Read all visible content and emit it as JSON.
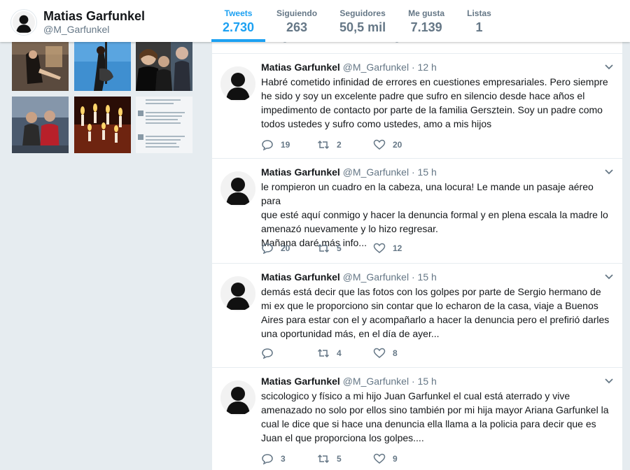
{
  "profile": {
    "name": "Matias Garfunkel",
    "handle": "@M_Garfunkel"
  },
  "stats": [
    {
      "label": "Tweets",
      "value": "2.730",
      "active": true
    },
    {
      "label": "Siguiendo",
      "value": "263",
      "active": false
    },
    {
      "label": "Seguidores",
      "value": "50,5 mil",
      "active": false
    },
    {
      "label": "Me gusta",
      "value": "7.139",
      "active": false
    },
    {
      "label": "Listas",
      "value": "1",
      "active": false
    }
  ],
  "photos": [
    {
      "desc": "woman-indoor-photo",
      "color": "#5a4a3e"
    },
    {
      "desc": "guitarist-photo",
      "color": "#3f8fd0"
    },
    {
      "desc": "politicians-photo",
      "color": "#3a3a3a"
    },
    {
      "desc": "two-men-photo",
      "color": "#4b5a6e"
    },
    {
      "desc": "candles-photo",
      "color": "#6e2410"
    },
    {
      "desc": "tweet-screenshot-photo",
      "color": "#f3f5f7"
    }
  ],
  "tweets": [
    {
      "name": "Matias Garfunkel",
      "handle": "@M_Garfunkel",
      "time": "12 h",
      "lines": [
        "Habré cometido infinidad de errores en cuestiones empresariales. Pero siempre",
        "he sido y soy un excelente padre que sufro en silencio desde hace años el",
        "impedimento de contacto por parte de la familia Gersztein. Soy un padre como",
        "todos ustedes y sufro como ustedes, amo a mis hijos"
      ],
      "replies": "19",
      "retweets": "2",
      "likes": "20"
    },
    {
      "name": "Matias Garfunkel",
      "handle": "@M_Garfunkel",
      "time": "15 h",
      "lines": [
        "le rompieron un cuadro en la cabeza, una locura! Le mande un pasaje aéreo para",
        "que esté aquí conmigo y hacer la denuncia formal y en plena escala la madre lo",
        "amenazó nuevamente y lo hizo regresar.",
        "Mañana daré más info..."
      ],
      "replies": "20",
      "retweets": "5",
      "likes": "12"
    },
    {
      "name": "Matias Garfunkel",
      "handle": "@M_Garfunkel",
      "time": "15 h",
      "lines": [
        "demás está decir que las fotos con los golpes por parte de Sergio hermano de",
        "mi ex que le proporciono sin contar que lo echaron de la casa, viaje a Buenos",
        "Aires para estar con el y acompañarlo a hacer la denuncia pero el prefirió darles",
        "una oportunidad más, en el día de ayer..."
      ],
      "replies": "",
      "retweets": "4",
      "likes": "8"
    },
    {
      "name": "Matias Garfunkel",
      "handle": "@M_Garfunkel",
      "time": "15 h",
      "lines": [
        "scicologico y físico a mi hijo Juan Garfunkel el cual está aterrado y vive",
        "amenazado no solo por ellos sino también por mi hija mayor Ariana Garfunkel la",
        "cual le dice que si hace una denuncia ella llama a la policia para decir que es",
        "Juan el que proporciona los golpes...."
      ],
      "replies": "3",
      "retweets": "5",
      "likes": "9"
    }
  ],
  "separator": "·",
  "colors": {
    "accent": "#1da1f2",
    "muted": "#657786",
    "background": "#e6ecf0"
  }
}
